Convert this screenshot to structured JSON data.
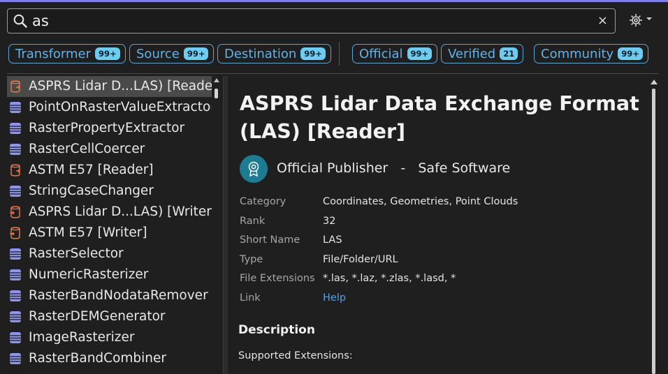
{
  "search": {
    "query": "as",
    "clear_glyph": "×"
  },
  "settings_icon": "gear-icon",
  "filters": [
    {
      "label": "Transformer",
      "count": "99+"
    },
    {
      "label": "Source",
      "count": "99+"
    },
    {
      "label": "Destination",
      "count": "99+"
    },
    {
      "label": "Official",
      "count": "99+"
    },
    {
      "label": "Verified",
      "count": "21"
    },
    {
      "label": "Community",
      "count": "99+"
    }
  ],
  "results": [
    {
      "label": "ASPRS Lidar D...LAS) [Reader]",
      "kind": "reader",
      "selected": true
    },
    {
      "label": "PointOnRasterValueExtractor",
      "kind": "transformer"
    },
    {
      "label": "RasterPropertyExtractor",
      "kind": "transformer"
    },
    {
      "label": "RasterCellCoercer",
      "kind": "transformer"
    },
    {
      "label": "ASTM E57 [Reader]",
      "kind": "reader"
    },
    {
      "label": "StringCaseChanger",
      "kind": "transformer"
    },
    {
      "label": "ASPRS Lidar D...LAS) [Writer]",
      "kind": "writer"
    },
    {
      "label": "ASTM E57 [Writer]",
      "kind": "writer"
    },
    {
      "label": "RasterSelector",
      "kind": "transformer"
    },
    {
      "label": "NumericRasterizer",
      "kind": "transformer"
    },
    {
      "label": "RasterBandNodataRemover",
      "kind": "transformer"
    },
    {
      "label": "RasterDEMGenerator",
      "kind": "transformer"
    },
    {
      "label": "ImageRasterizer",
      "kind": "transformer"
    },
    {
      "label": "RasterBandCombiner",
      "kind": "transformer"
    },
    {
      "label": "",
      "kind": "transformer"
    }
  ],
  "detail": {
    "title": "ASPRS Lidar Data Exchange Format (LAS) [Reader]",
    "publisher_type": "Official Publisher",
    "publisher_sep": "-",
    "publisher_name": "Safe Software",
    "properties": [
      {
        "key": "Category",
        "value": "Coordinates, Geometries, Point Clouds"
      },
      {
        "key": "Rank",
        "value": "32"
      },
      {
        "key": "Short Name",
        "value": "LAS"
      },
      {
        "key": "Type",
        "value": "File/Folder/URL"
      },
      {
        "key": "File Extensions",
        "value": "*.las, *.laz, *.zlas, *.lasd, *"
      },
      {
        "key": "Link",
        "value": "Help",
        "is_link": true
      }
    ],
    "description_heading": "Description",
    "description_text": "Supported Extensions:"
  },
  "colors": {
    "accent": "#7d7fe6",
    "chip": "#5fb3e8",
    "badge": "#6ccdf2",
    "transformer_icon": "#8f94f2",
    "reader_writer_icon": "#e5744a",
    "publisher_badge": "#1c7c91",
    "link": "#4aa3f0"
  }
}
